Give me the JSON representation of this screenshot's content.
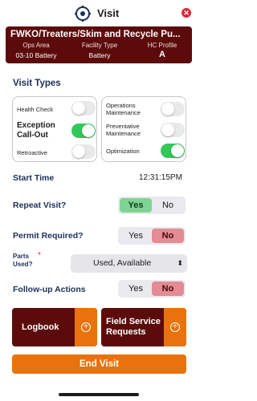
{
  "header": {
    "title": "Visit"
  },
  "banner": {
    "title": "FWKO/Treaters/Skim and Recycle Pu...",
    "ops_area_label": "Ops Area",
    "ops_area_value": "03-10 Battery",
    "facility_type_label": "Facility Type",
    "facility_type_value": "Battery",
    "hc_profile_label": "HC Profile",
    "hc_profile_value": "A",
    "color": "#5c0b0b"
  },
  "visit_types": {
    "title": "Visit Types",
    "left": [
      {
        "label": "Health Check",
        "on": false
      },
      {
        "label": "Exception Call-Out",
        "on": true
      },
      {
        "label": "Retroactive",
        "on": false
      }
    ],
    "right": [
      {
        "label": "Operations Maintenance",
        "on": false
      },
      {
        "label": "Preventative Maintenance",
        "on": false
      },
      {
        "label": "Optimization",
        "on": true
      }
    ]
  },
  "start_time": {
    "label": "Start Time",
    "value": "12:31:15PM"
  },
  "repeat_visit": {
    "label": "Repeat Visit?",
    "yes": "Yes",
    "no": "No",
    "selected": "Yes"
  },
  "permit_required": {
    "label": "Permit Required?",
    "yes": "Yes",
    "no": "No",
    "selected": "No"
  },
  "parts_used": {
    "label": "Parts Used?",
    "required_mark": "*",
    "value": "Used, Available",
    "chevron": "⌃⌄"
  },
  "followup": {
    "label": "Follow-up Actions",
    "yes": "Yes",
    "no": "No",
    "selected": "No"
  },
  "logbook_button": {
    "label": "Logbook"
  },
  "field_service_button": {
    "label": "Field Service Requests"
  },
  "end_visit_button": {
    "label": "End Visit"
  },
  "colors": {
    "accent": "#e8730c",
    "toggle_on": "#34c759",
    "yes_selected": "#7ed493",
    "no_selected": "#e58b93"
  }
}
